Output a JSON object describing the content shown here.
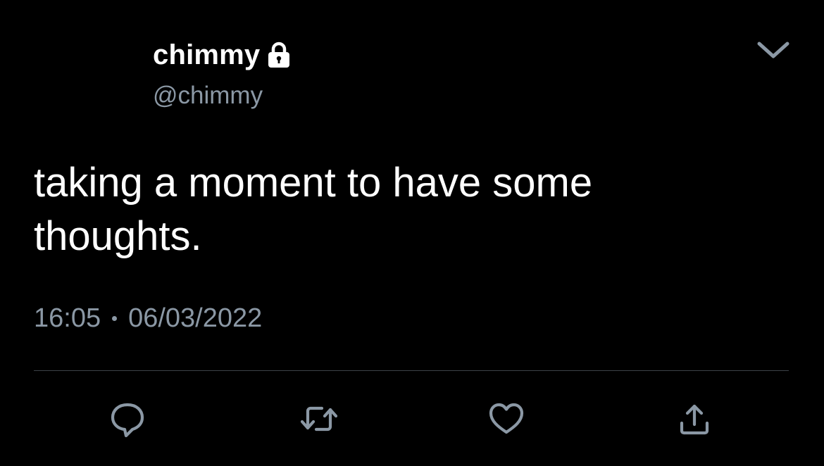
{
  "tweet": {
    "display_name": "chimmy",
    "handle": "@chimmy",
    "text": "taking a moment to have some\nthoughts.",
    "time": "16:05",
    "date": "06/03/2022",
    "icons": {
      "lock": "lock-icon",
      "more": "chevron-down-icon",
      "reply": "reply-icon",
      "retweet": "retweet-icon",
      "like": "heart-icon",
      "share": "share-icon"
    }
  },
  "colors": {
    "background": "#000000",
    "text": "#ffffff",
    "secondary": "#8b98a5",
    "divider": "#3d4248"
  }
}
